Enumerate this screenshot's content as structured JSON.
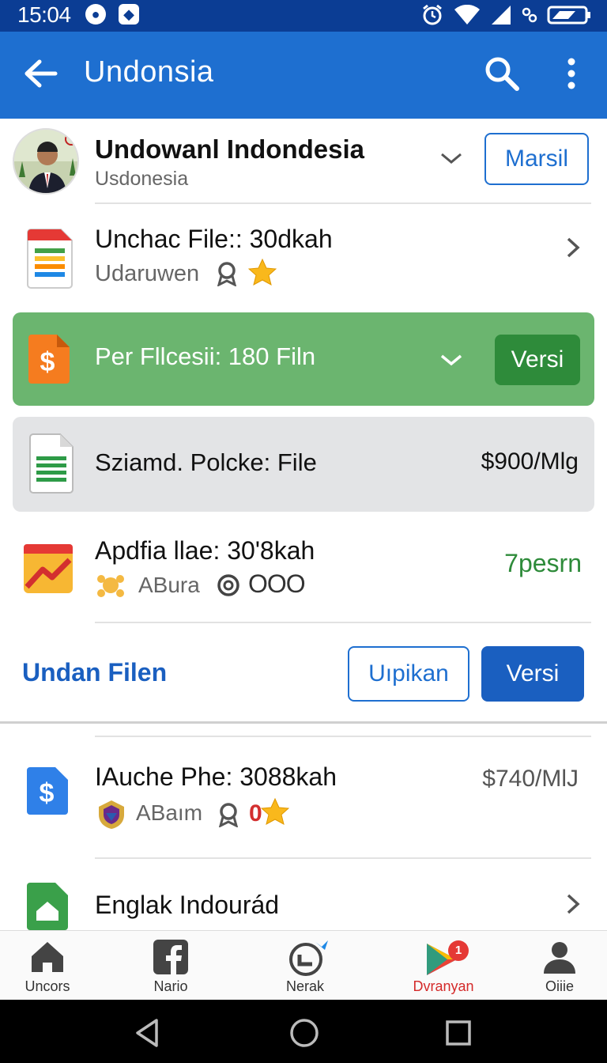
{
  "status_bar": {
    "time": "15:04"
  },
  "app_bar": {
    "title": "Undonsia"
  },
  "profile": {
    "name": "Undowanl Indondesia",
    "subtitle": "Usdonesia",
    "button_label": "Marsil"
  },
  "rows": [
    {
      "title": "Unchac File:: 30dkah",
      "subtitle": "Udaruwen"
    },
    {
      "title": "Per Fllcesii: 180 Filn",
      "button_label": "Versi"
    },
    {
      "title": "Sziamd. Polcke: File",
      "price": "$900/Mlg"
    },
    {
      "title": "Apdfia llae: 30'8kah",
      "subtitle": "ABura",
      "extra": "OOO",
      "status": "7pesrn",
      "status_color": "#2e8b3a"
    }
  ],
  "action_row": {
    "link_label": "Undan Filen",
    "outline_button": "Uıpikan",
    "solid_button": "Versi"
  },
  "rows_after": [
    {
      "title": "IAuche Phe: 3088kah",
      "subtitle": "ABaım",
      "badge_num": "0",
      "price": "$740/MlJ"
    },
    {
      "title": "Englak Indourád"
    }
  ],
  "bottom_nav": [
    {
      "label": "Uncors",
      "icon": "home-icon"
    },
    {
      "label": "Nario",
      "icon": "facebook-icon"
    },
    {
      "label": "Nerak",
      "icon": "clock-icon"
    },
    {
      "label": "Dvranyan",
      "icon": "play-store-icon",
      "badge": "1",
      "active_color": "#d42a2a"
    },
    {
      "label": "Oiiie",
      "icon": "person-icon"
    }
  ],
  "colors": {
    "app_bar": "#1e6fd0",
    "status_bar": "#0b3d94",
    "green_card": "#6bb56f",
    "grey_card": "#e3e4e6"
  }
}
